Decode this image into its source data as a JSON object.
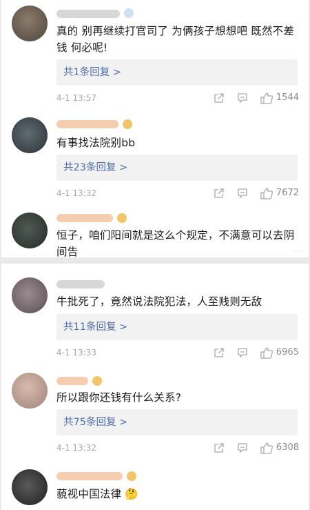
{
  "comments": [
    {
      "text": "真的 别再继续打官司了 为俩孩子想想吧 既然不差钱 何必呢!",
      "reply": "共1条回复 >",
      "time": "4-1 13:57",
      "likes": "1544"
    },
    {
      "text": "有事找法院别bb",
      "reply": "共23条回复 >",
      "time": "4-1 13:32",
      "likes": "7672"
    },
    {
      "text": "恒子，咱们阳间就是这么个规定，不满意可以去阴间告"
    },
    {
      "text": "牛批死了，竟然说法院犯法，人至贱则无敌",
      "reply": "共11条回复 >",
      "time": "4-1 13:33",
      "likes": "6965"
    },
    {
      "text": "所以跟你还钱有什么关系?",
      "reply": "共75条回复 >",
      "time": "4-1 13:32",
      "likes": "6308"
    },
    {
      "text": "藐视中国法律 🤔"
    }
  ],
  "icons": {
    "share": "share-icon",
    "comment": "comment-icon",
    "like": "thumbs-up-icon",
    "badge": "vip-badge-icon"
  },
  "colors": {
    "reply_link": "#4d6ea8",
    "background": "#ffffff",
    "separator": "#e9e9e9"
  }
}
